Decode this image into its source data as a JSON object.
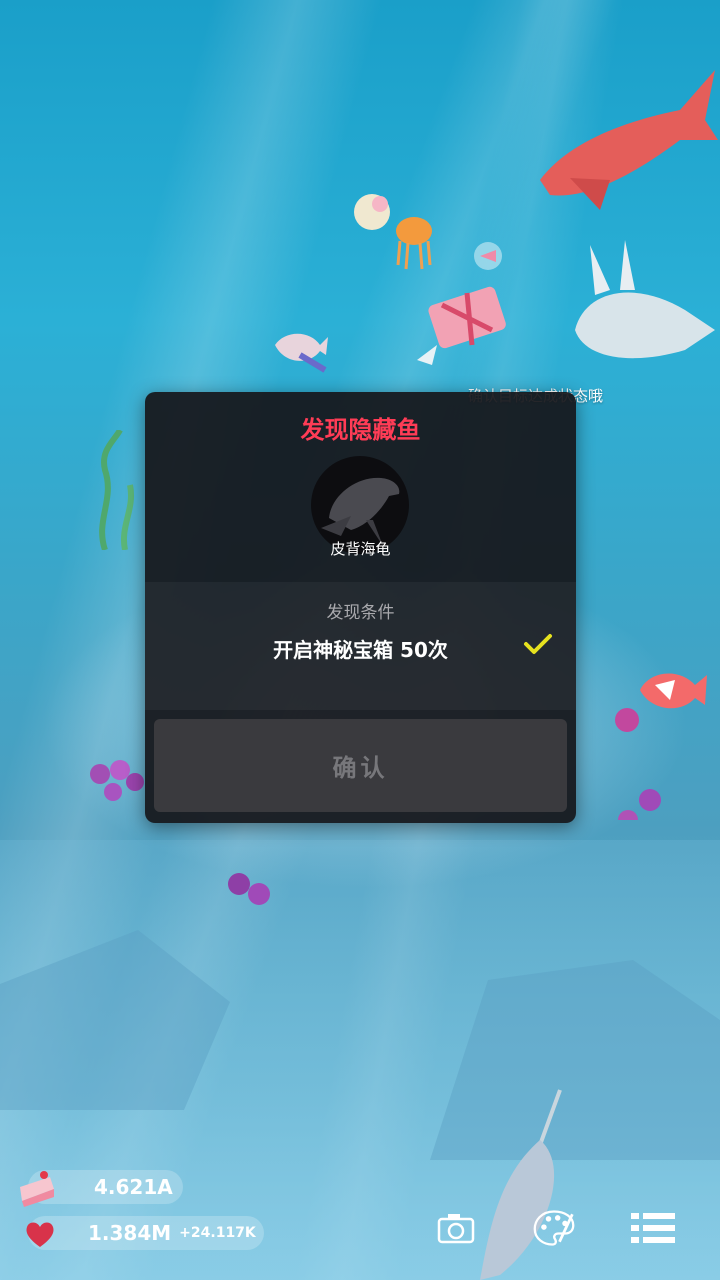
{
  "notification": {
    "text": "确认目标达成状态哦"
  },
  "modal": {
    "title": "发现隐藏鱼",
    "fish_name": "皮背海龟",
    "condition_label": "发现条件",
    "condition_text": "开启神秘宝箱 50次",
    "condition_met": true,
    "confirm_label": "确认"
  },
  "hud": {
    "cake_value": "4.621A",
    "heart_value": "1.384M",
    "heart_rate": "+24.117K"
  },
  "icons": {
    "cake": "cake-icon",
    "heart": "heart-icon",
    "camera": "camera-icon",
    "palette": "palette-icon",
    "menu": "list-menu-icon",
    "check": "checkmark-icon"
  },
  "colors": {
    "title_red": "#ff3c56",
    "check_yellow": "#e6e21f",
    "modal_bg": "#16161a"
  }
}
